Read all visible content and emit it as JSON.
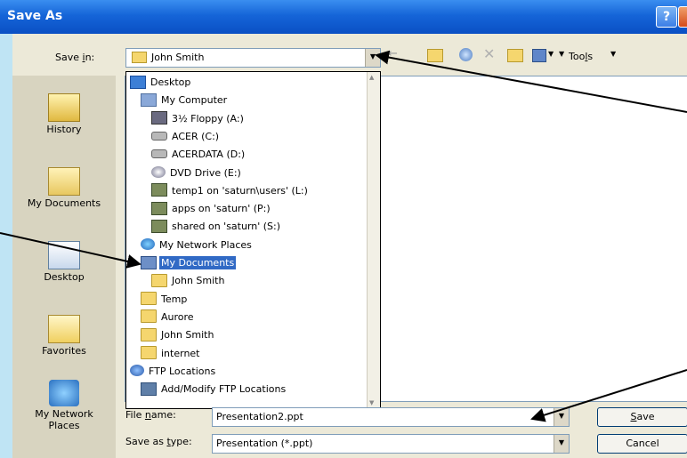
{
  "window": {
    "title": "Save As",
    "help_glyph": "?"
  },
  "toolbar": {
    "save_in_label_pre": "Save ",
    "save_in_label_key": "i",
    "save_in_label_post": "n:",
    "save_in_value": "John Smith",
    "tools_pre": "Too",
    "tools_key": "l",
    "tools_post": "s",
    "icons": [
      "back-icon",
      "up-folder-icon",
      "search-web-icon",
      "delete-icon",
      "new-folder-icon",
      "views-icon",
      "tools-dropdown-icon"
    ]
  },
  "places": [
    {
      "label": "History",
      "icon": "history-icon"
    },
    {
      "label": "My Documents",
      "icon": "my-documents-icon"
    },
    {
      "label": "Desktop",
      "icon": "desktop-icon"
    },
    {
      "label": "Favorites",
      "icon": "favorites-icon"
    },
    {
      "label_line1": "My Network",
      "label_line2": "Places",
      "icon": "network-places-icon"
    }
  ],
  "dropdown": {
    "items": [
      {
        "label": "Desktop",
        "icon": "desktop-icon",
        "level": 0
      },
      {
        "label": "My Computer",
        "icon": "computer-icon",
        "level": 1
      },
      {
        "label": "3½ Floppy (A:)",
        "icon": "floppy-icon",
        "level": 2
      },
      {
        "label": "ACER (C:)",
        "icon": "drive-icon",
        "level": 2
      },
      {
        "label": "ACERDATA (D:)",
        "icon": "drive-icon",
        "level": 2
      },
      {
        "label": "DVD Drive (E:)",
        "icon": "dvd-icon",
        "level": 2
      },
      {
        "label": "temp1 on 'saturn\\users' (L:)",
        "icon": "network-drive-icon",
        "level": 2
      },
      {
        "label": "apps on 'saturn' (P:)",
        "icon": "network-drive-icon",
        "level": 2
      },
      {
        "label": "shared on 'saturn' (S:)",
        "icon": "network-drive-icon",
        "level": 2
      },
      {
        "label": "My Network Places",
        "icon": "network-places-icon",
        "level": 1
      },
      {
        "label": "My Documents",
        "icon": "my-documents-icon",
        "level": 1,
        "selected": true
      },
      {
        "label": "John Smith",
        "icon": "folder-icon",
        "level": 2
      },
      {
        "label": "Temp",
        "icon": "folder-icon",
        "level": 1
      },
      {
        "label": "Aurore",
        "icon": "folder-icon",
        "level": 1
      },
      {
        "label": "John Smith",
        "icon": "folder-icon",
        "level": 1
      },
      {
        "label": "internet",
        "icon": "folder-icon",
        "level": 1
      },
      {
        "label": "FTP Locations",
        "icon": "ftp-icon",
        "level": 0
      },
      {
        "label": "Add/Modify FTP Locations",
        "icon": "ftp-add-icon",
        "level": 1
      }
    ]
  },
  "form": {
    "file_name_label_pre": "File ",
    "file_name_label_key": "n",
    "file_name_label_post": "ame:",
    "file_name_value": "Presentation2.ppt",
    "save_type_label_pre": "Save as ",
    "save_type_label_key": "t",
    "save_type_label_post": "ype:",
    "save_type_value": "Presentation (*.ppt)",
    "save_button_key": "S",
    "save_button_post": "ave",
    "cancel_button": "Cancel"
  },
  "colors": {
    "titlebar": "#1565d8",
    "selection": "#316ac5",
    "dialog_bg": "#ece9d8",
    "page_bg": "#bfe4f4"
  }
}
